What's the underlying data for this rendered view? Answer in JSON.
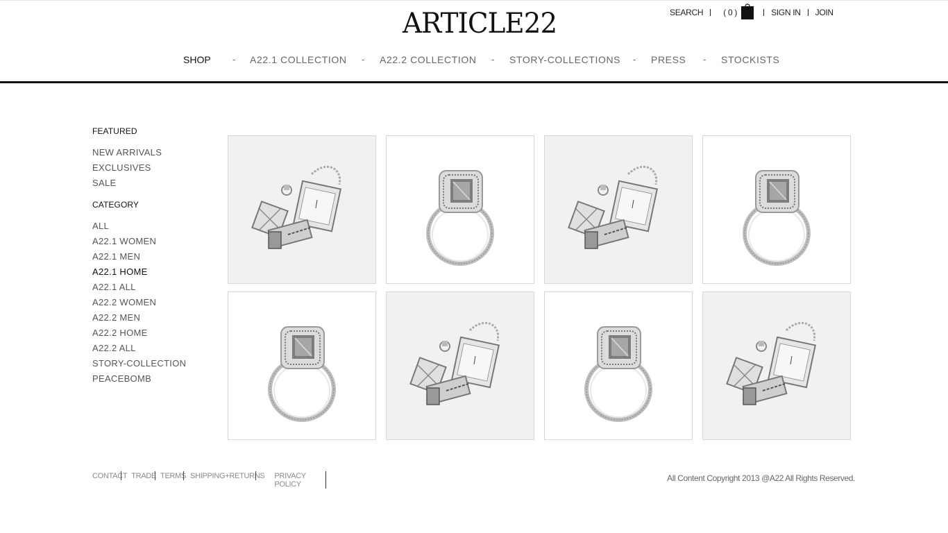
{
  "brand": {
    "logo_text": "ARTICLE22"
  },
  "utility": {
    "search": "SEARCH",
    "cart_count": "( 0 )",
    "sign_in": "SIGN IN",
    "join": "JOIN",
    "bag_icon": "shopping-bag-icon"
  },
  "nav": {
    "items": [
      {
        "label": "SHOP",
        "active": true
      },
      {
        "label": "A22.1 COLLECTION"
      },
      {
        "label": "A22.2 COLLECTION"
      },
      {
        "label": "STORY-COLLECTIONS"
      },
      {
        "label": "PRESS"
      },
      {
        "label": "STOCKISTS"
      }
    ],
    "separator": "-"
  },
  "sidebar": {
    "featured_heading": "FEATURED",
    "featured": [
      "NEW ARRIVALS",
      "EXCLUSIVES",
      "SALE"
    ],
    "category_heading": "CATEGORY",
    "categories": [
      "ALL",
      "A22.1 WOMEN",
      "A22.1 MEN",
      "A22.1 HOME",
      "A22.1 ALL",
      "A22.2 WOMEN",
      "A22.2 MEN",
      "A22.2 HOME",
      "A22.2 ALL",
      "STORY-COLLECTION",
      "PEACEBOMB"
    ],
    "active_category": "A22.1 HOME"
  },
  "products": [
    {
      "image": "watch-and-pendants",
      "background": "pink"
    },
    {
      "image": "diamond-ring",
      "background": "white"
    },
    {
      "image": "watch-and-pendants",
      "background": "pink"
    },
    {
      "image": "diamond-ring",
      "background": "white"
    },
    {
      "image": "diamond-ring",
      "background": "white"
    },
    {
      "image": "watch-and-pendants",
      "background": "pink"
    },
    {
      "image": "diamond-ring",
      "background": "white"
    },
    {
      "image": "watch-and-pendants",
      "background": "pink"
    }
  ],
  "footer": {
    "links": [
      "CONTACT",
      "TRADE",
      "TERMS",
      "SHIPPING+RETURNS"
    ],
    "privacy": "PRIVACY POLICY",
    "copyright": "All Content Copyright 2013 @A22 All Rights Reserved."
  },
  "colors": {
    "accent": "#111111",
    "tile_pink": "#f3f0f0",
    "text_muted": "#666666"
  }
}
